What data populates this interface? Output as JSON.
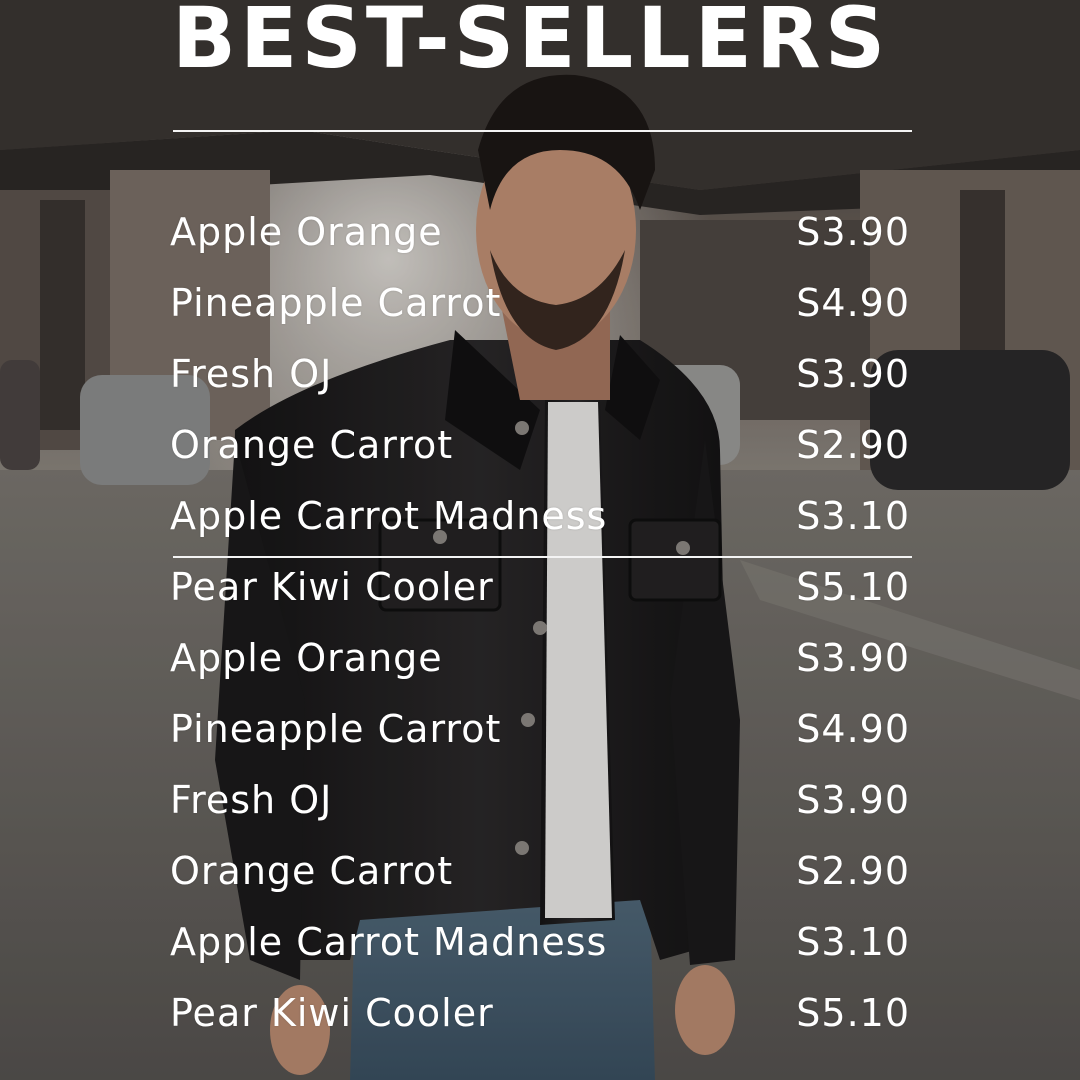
{
  "title": "BEST-SELLERS",
  "menu": [
    {
      "name": "Apple Orange",
      "price": "S3.90"
    },
    {
      "name": "Pineapple Carrot",
      "price": "S4.90"
    },
    {
      "name": "Fresh OJ",
      "price": "S3.90"
    },
    {
      "name": "Orange Carrot",
      "price": "S2.90"
    },
    {
      "name": "Apple Carrot Madness",
      "price": "S3.10"
    },
    {
      "name": "Pear Kiwi Cooler",
      "price": "S5.10"
    },
    {
      "name": "Apple Orange",
      "price": "S3.90"
    },
    {
      "name": "Pineapple Carrot",
      "price": "S4.90"
    },
    {
      "name": "Fresh OJ",
      "price": "S3.90"
    },
    {
      "name": "Orange Carrot",
      "price": "S2.90"
    },
    {
      "name": "Apple Carrot Madness",
      "price": "S3.10"
    },
    {
      "name": "Pear Kiwi Cooler",
      "price": "S5.10"
    }
  ],
  "colors": {
    "text": "#ffffff",
    "rule": "#f4f4f4",
    "jacket": "#1c1b1c",
    "shirt": "#e9e8e5",
    "street": "#6b6763"
  }
}
